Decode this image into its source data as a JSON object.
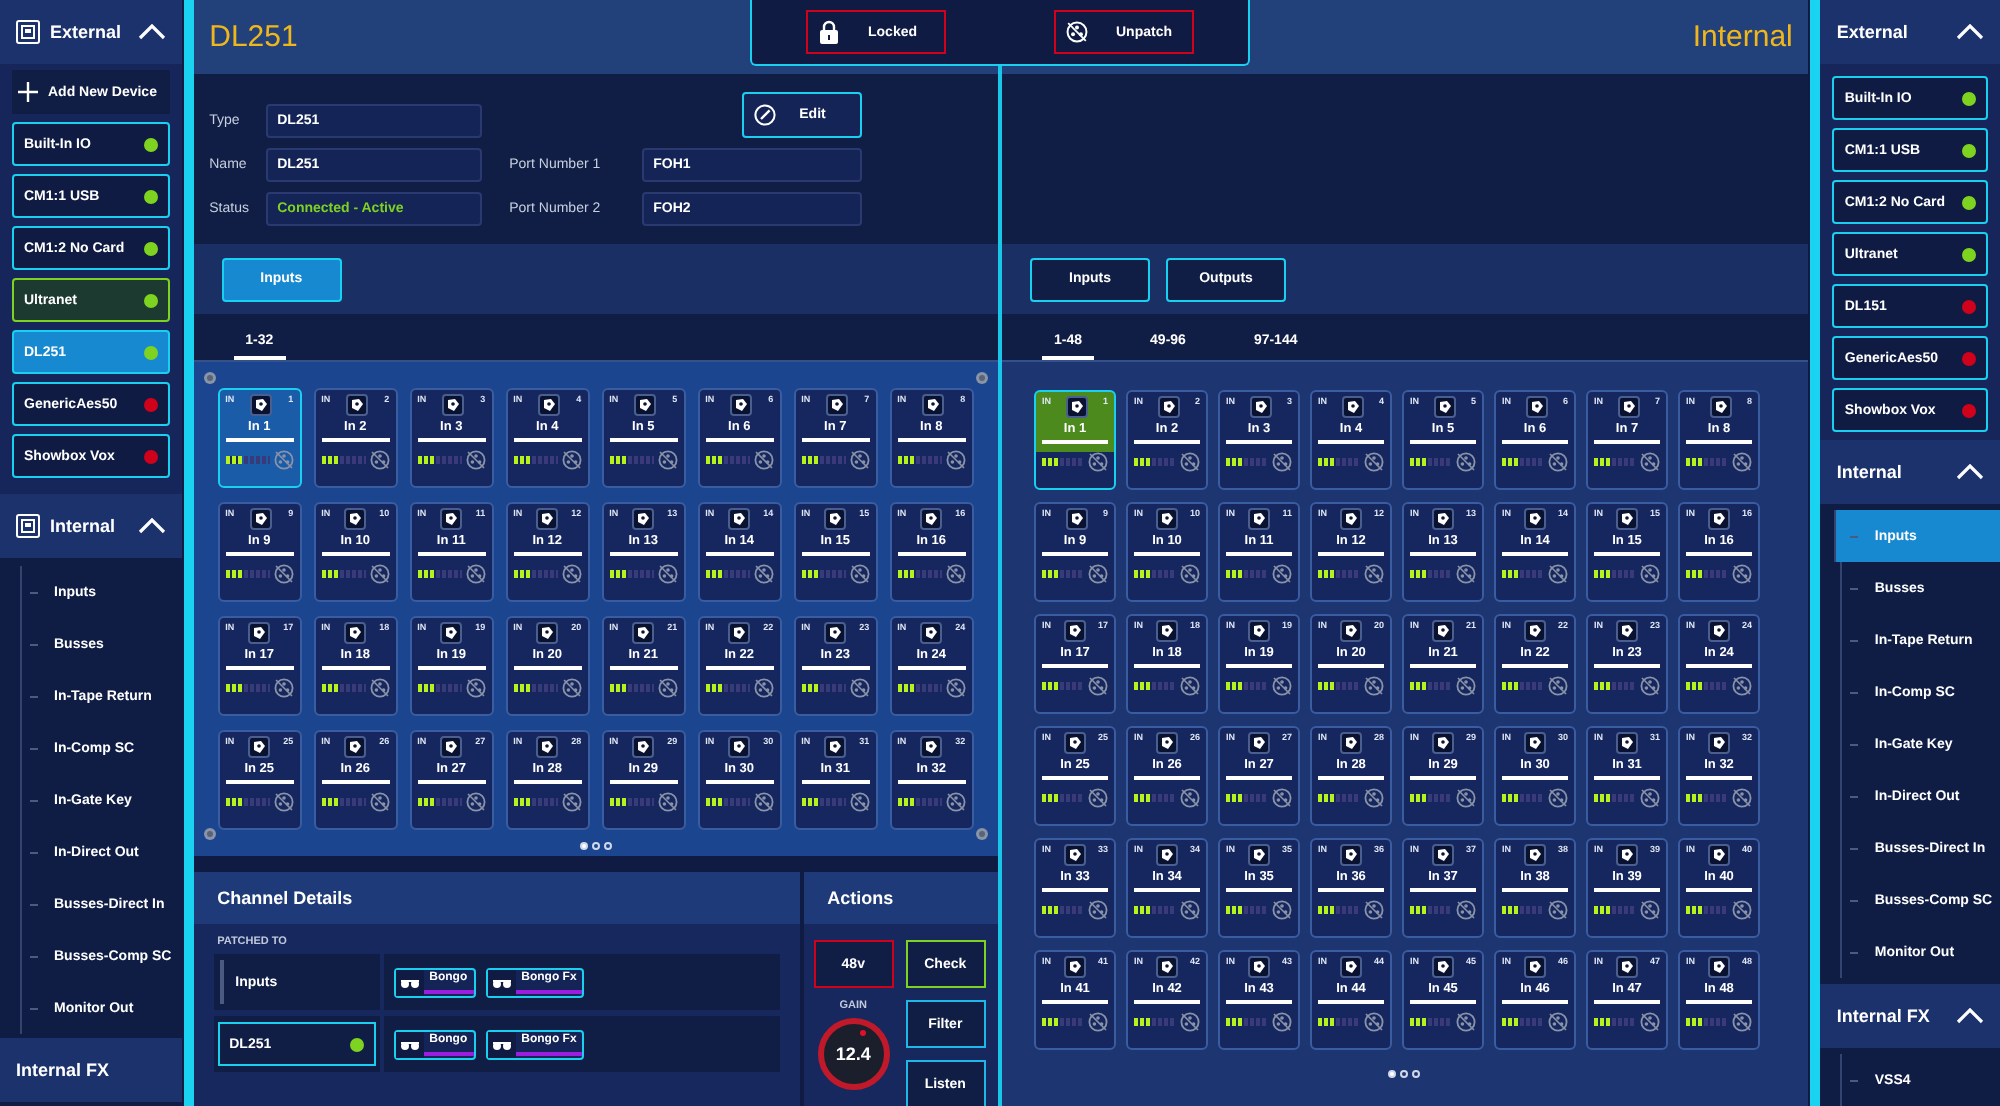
{
  "left_sidebar": {
    "external": {
      "title": "External",
      "expanded": true,
      "add_button": "Add New Device",
      "devices": [
        {
          "name": "Built-In IO",
          "color": "#7ed321",
          "selected": false,
          "linked": false
        },
        {
          "name": "CM1:1 USB",
          "color": "#7ed321",
          "selected": false,
          "linked": false
        },
        {
          "name": "CM1:2 No Card",
          "color": "#7ed321",
          "selected": false,
          "linked": false
        },
        {
          "name": "Ultranet",
          "color": "#7ed321",
          "selected": false,
          "linked": true
        },
        {
          "name": "DL251",
          "color": "#7ed321",
          "selected": true,
          "linked": false
        },
        {
          "name": "GenericAes50",
          "color": "#d0021b",
          "selected": false,
          "linked": false
        },
        {
          "name": "Showbox Vox",
          "color": "#d0021b",
          "selected": false,
          "linked": false
        }
      ]
    },
    "internal": {
      "title": "Internal",
      "expanded": true,
      "items": [
        {
          "label": "Inputs",
          "selected": false
        },
        {
          "label": "Busses",
          "selected": false
        },
        {
          "label": "In-Tape Return",
          "selected": false
        },
        {
          "label": "In-Comp SC",
          "selected": false
        },
        {
          "label": "In-Gate Key",
          "selected": false
        },
        {
          "label": "In-Direct Out",
          "selected": false
        },
        {
          "label": "Busses-Direct In",
          "selected": false
        },
        {
          "label": "Busses-Comp SC",
          "selected": false
        },
        {
          "label": "Monitor Out",
          "selected": false
        }
      ]
    },
    "internal_fx": {
      "title": "Internal FX",
      "expanded": false
    }
  },
  "toolbar": {
    "buttons": [
      {
        "label": "Locked",
        "kind": "lock"
      },
      {
        "label": "Unpatch",
        "kind": "unpatch"
      }
    ]
  },
  "device_panel": {
    "title": "DL251",
    "edit_button": "Edit",
    "fields": [
      {
        "label": "Type",
        "value": "DL251",
        "kind": "plain"
      },
      {
        "label": "Name",
        "value": "DL251",
        "kind": "plain"
      },
      {
        "label": "Status",
        "value": "Connected - Active",
        "kind": "status"
      }
    ],
    "port_fields": [
      {
        "label": "Port Number 1",
        "value": "FOH1"
      },
      {
        "label": "Port Number 2",
        "value": "FOH2"
      }
    ],
    "tabs": [
      {
        "label": "Inputs",
        "selected": true
      }
    ],
    "ranges": [
      {
        "label": "1-32",
        "selected": true
      }
    ],
    "channels": [
      {
        "tag": "IN",
        "number": "1",
        "name": "In 1",
        "selected": true,
        "level": 0.375
      },
      {
        "tag": "IN",
        "number": "2",
        "name": "In 2",
        "selected": false,
        "level": 0.375
      },
      {
        "tag": "IN",
        "number": "3",
        "name": "In 3",
        "selected": false,
        "level": 0.375
      },
      {
        "tag": "IN",
        "number": "4",
        "name": "In 4",
        "selected": false,
        "level": 0.375
      },
      {
        "tag": "IN",
        "number": "5",
        "name": "In 5",
        "selected": false,
        "level": 0.375
      },
      {
        "tag": "IN",
        "number": "6",
        "name": "In 6",
        "selected": false,
        "level": 0.375
      },
      {
        "tag": "IN",
        "number": "7",
        "name": "In 7",
        "selected": false,
        "level": 0.375
      },
      {
        "tag": "IN",
        "number": "8",
        "name": "In 8",
        "selected": false,
        "level": 0.375
      },
      {
        "tag": "IN",
        "number": "9",
        "name": "In 9",
        "selected": false,
        "level": 0.375
      },
      {
        "tag": "IN",
        "number": "10",
        "name": "In 10",
        "selected": false,
        "level": 0.375
      },
      {
        "tag": "IN",
        "number": "11",
        "name": "In 11",
        "selected": false,
        "level": 0.375
      },
      {
        "tag": "IN",
        "number": "12",
        "name": "In 12",
        "selected": false,
        "level": 0.375
      },
      {
        "tag": "IN",
        "number": "13",
        "name": "In 13",
        "selected": false,
        "level": 0.375
      },
      {
        "tag": "IN",
        "number": "14",
        "name": "In 14",
        "selected": false,
        "level": 0.375
      },
      {
        "tag": "IN",
        "number": "15",
        "name": "In 15",
        "selected": false,
        "level": 0.375
      },
      {
        "tag": "IN",
        "number": "16",
        "name": "In 16",
        "selected": false,
        "level": 0.375
      },
      {
        "tag": "IN",
        "number": "17",
        "name": "In 17",
        "selected": false,
        "level": 0.375
      },
      {
        "tag": "IN",
        "number": "18",
        "name": "In 18",
        "selected": false,
        "level": 0.375
      },
      {
        "tag": "IN",
        "number": "19",
        "name": "In 19",
        "selected": false,
        "level": 0.375
      },
      {
        "tag": "IN",
        "number": "20",
        "name": "In 20",
        "selected": false,
        "level": 0.375
      },
      {
        "tag": "IN",
        "number": "21",
        "name": "In 21",
        "selected": false,
        "level": 0.375
      },
      {
        "tag": "IN",
        "number": "22",
        "name": "In 22",
        "selected": false,
        "level": 0.375
      },
      {
        "tag": "IN",
        "number": "23",
        "name": "In 23",
        "selected": false,
        "level": 0.375
      },
      {
        "tag": "IN",
        "number": "24",
        "name": "In 24",
        "selected": false,
        "level": 0.375
      },
      {
        "tag": "IN",
        "number": "25",
        "name": "In 25",
        "selected": false,
        "level": 0.375
      },
      {
        "tag": "IN",
        "number": "26",
        "name": "In 26",
        "selected": false,
        "level": 0.375
      },
      {
        "tag": "IN",
        "number": "27",
        "name": "In 27",
        "selected": false,
        "level": 0.375
      },
      {
        "tag": "IN",
        "number": "28",
        "name": "In 28",
        "selected": false,
        "level": 0.375
      },
      {
        "tag": "IN",
        "number": "29",
        "name": "In 29",
        "selected": false,
        "level": 0.375
      },
      {
        "tag": "IN",
        "number": "30",
        "name": "In 30",
        "selected": false,
        "level": 0.375
      },
      {
        "tag": "IN",
        "number": "31",
        "name": "In 31",
        "selected": false,
        "level": 0.375
      },
      {
        "tag": "IN",
        "number": "32",
        "name": "In 32",
        "selected": false,
        "level": 0.375
      }
    ],
    "pages": [
      {
        "selected": true
      },
      {
        "selected": false
      },
      {
        "selected": false
      }
    ]
  },
  "internal_panel": {
    "title": "Internal",
    "tabs": [
      {
        "label": "Inputs",
        "selected": false
      },
      {
        "label": "Outputs",
        "selected": false
      }
    ],
    "ranges": [
      {
        "label": "1-48",
        "selected": true
      },
      {
        "label": "49-96",
        "selected": false
      },
      {
        "label": "97-144",
        "selected": false
      }
    ],
    "channels": [
      {
        "tag": "IN",
        "number": "1",
        "name": "In 1",
        "selected": true,
        "level": 0.375
      },
      {
        "tag": "IN",
        "number": "2",
        "name": "In 2",
        "selected": false,
        "level": 0.375
      },
      {
        "tag": "IN",
        "number": "3",
        "name": "In 3",
        "selected": false,
        "level": 0.375
      },
      {
        "tag": "IN",
        "number": "4",
        "name": "In 4",
        "selected": false,
        "level": 0.375
      },
      {
        "tag": "IN",
        "number": "5",
        "name": "In 5",
        "selected": false,
        "level": 0.375
      },
      {
        "tag": "IN",
        "number": "6",
        "name": "In 6",
        "selected": false,
        "level": 0.375
      },
      {
        "tag": "IN",
        "number": "7",
        "name": "In 7",
        "selected": false,
        "level": 0.375
      },
      {
        "tag": "IN",
        "number": "8",
        "name": "In 8",
        "selected": false,
        "level": 0.375
      },
      {
        "tag": "IN",
        "number": "9",
        "name": "In 9",
        "selected": false,
        "level": 0.375
      },
      {
        "tag": "IN",
        "number": "10",
        "name": "In 10",
        "selected": false,
        "level": 0.375
      },
      {
        "tag": "IN",
        "number": "11",
        "name": "In 11",
        "selected": false,
        "level": 0.375
      },
      {
        "tag": "IN",
        "number": "12",
        "name": "In 12",
        "selected": false,
        "level": 0.375
      },
      {
        "tag": "IN",
        "number": "13",
        "name": "In 13",
        "selected": false,
        "level": 0.375
      },
      {
        "tag": "IN",
        "number": "14",
        "name": "In 14",
        "selected": false,
        "level": 0.375
      },
      {
        "tag": "IN",
        "number": "15",
        "name": "In 15",
        "selected": false,
        "level": 0.375
      },
      {
        "tag": "IN",
        "number": "16",
        "name": "In 16",
        "selected": false,
        "level": 0.375
      },
      {
        "tag": "IN",
        "number": "17",
        "name": "In 17",
        "selected": false,
        "level": 0.375
      },
      {
        "tag": "IN",
        "number": "18",
        "name": "In 18",
        "selected": false,
        "level": 0.375
      },
      {
        "tag": "IN",
        "number": "19",
        "name": "In 19",
        "selected": false,
        "level": 0.375
      },
      {
        "tag": "IN",
        "number": "20",
        "name": "In 20",
        "selected": false,
        "level": 0.375
      },
      {
        "tag": "IN",
        "number": "21",
        "name": "In 21",
        "selected": false,
        "level": 0.375
      },
      {
        "tag": "IN",
        "number": "22",
        "name": "In 22",
        "selected": false,
        "level": 0.375
      },
      {
        "tag": "IN",
        "number": "23",
        "name": "In 23",
        "selected": false,
        "level": 0.375
      },
      {
        "tag": "IN",
        "number": "24",
        "name": "In 24",
        "selected": false,
        "level": 0.375
      },
      {
        "tag": "IN",
        "number": "25",
        "name": "In 25",
        "selected": false,
        "level": 0.375
      },
      {
        "tag": "IN",
        "number": "26",
        "name": "In 26",
        "selected": false,
        "level": 0.375
      },
      {
        "tag": "IN",
        "number": "27",
        "name": "In 27",
        "selected": false,
        "level": 0.375
      },
      {
        "tag": "IN",
        "number": "28",
        "name": "In 28",
        "selected": false,
        "level": 0.375
      },
      {
        "tag": "IN",
        "number": "29",
        "name": "In 29",
        "selected": false,
        "level": 0.375
      },
      {
        "tag": "IN",
        "number": "30",
        "name": "In 30",
        "selected": false,
        "level": 0.375
      },
      {
        "tag": "IN",
        "number": "31",
        "name": "In 31",
        "selected": false,
        "level": 0.375
      },
      {
        "tag": "IN",
        "number": "32",
        "name": "In 32",
        "selected": false,
        "level": 0.375
      },
      {
        "tag": "IN",
        "number": "33",
        "name": "In 33",
        "selected": false,
        "level": 0.375
      },
      {
        "tag": "IN",
        "number": "34",
        "name": "In 34",
        "selected": false,
        "level": 0.375
      },
      {
        "tag": "IN",
        "number": "35",
        "name": "In 35",
        "selected": false,
        "level": 0.375
      },
      {
        "tag": "IN",
        "number": "36",
        "name": "In 36",
        "selected": false,
        "level": 0.375
      },
      {
        "tag": "IN",
        "number": "37",
        "name": "In 37",
        "selected": false,
        "level": 0.375
      },
      {
        "tag": "IN",
        "number": "38",
        "name": "In 38",
        "selected": false,
        "level": 0.375
      },
      {
        "tag": "IN",
        "number": "39",
        "name": "In 39",
        "selected": false,
        "level": 0.375
      },
      {
        "tag": "IN",
        "number": "40",
        "name": "In 40",
        "selected": false,
        "level": 0.375
      },
      {
        "tag": "IN",
        "number": "41",
        "name": "In 41",
        "selected": false,
        "level": 0.375
      },
      {
        "tag": "IN",
        "number": "42",
        "name": "In 42",
        "selected": false,
        "level": 0.375
      },
      {
        "tag": "IN",
        "number": "43",
        "name": "In 43",
        "selected": false,
        "level": 0.375
      },
      {
        "tag": "IN",
        "number": "44",
        "name": "In 44",
        "selected": false,
        "level": 0.375
      },
      {
        "tag": "IN",
        "number": "45",
        "name": "In 45",
        "selected": false,
        "level": 0.375
      },
      {
        "tag": "IN",
        "number": "46",
        "name": "In 46",
        "selected": false,
        "level": 0.375
      },
      {
        "tag": "IN",
        "number": "47",
        "name": "In 47",
        "selected": false,
        "level": 0.375
      },
      {
        "tag": "IN",
        "number": "48",
        "name": "In 48",
        "selected": false,
        "level": 0.375
      }
    ],
    "pages": [
      {
        "selected": true
      },
      {
        "selected": false
      },
      {
        "selected": false
      }
    ]
  },
  "channel_details": {
    "title": "Channel Details",
    "patched_to_label": "PATCHED TO",
    "rows": [
      {
        "source": "Inputs",
        "kind": "group",
        "targets": [
          "Bongo",
          "Bongo Fx"
        ]
      },
      {
        "source": "DL251",
        "kind": "device",
        "color": "#7ed321",
        "targets": [
          "Bongo",
          "Bongo Fx"
        ]
      }
    ]
  },
  "actions": {
    "title": "Actions",
    "buttons": [
      {
        "label": "48v",
        "color": "#d0021b"
      },
      {
        "label": "Check",
        "color": "#7ed321"
      },
      {
        "label": "Filter",
        "color": "#1fb6e8"
      },
      {
        "label": "Listen",
        "color": "#1fb6e8"
      }
    ],
    "gain": {
      "label": "GAIN",
      "value": "12.4"
    }
  },
  "right_sidebar": {
    "external": {
      "title": "External",
      "expanded": true,
      "devices": [
        {
          "name": "Built-In IO",
          "color": "#7ed321",
          "selected": false,
          "linked": false
        },
        {
          "name": "CM1:1 USB",
          "color": "#7ed321",
          "selected": false,
          "linked": false
        },
        {
          "name": "CM1:2 No Card",
          "color": "#7ed321",
          "selected": false,
          "linked": false
        },
        {
          "name": "Ultranet",
          "color": "#7ed321",
          "selected": false,
          "linked": false
        },
        {
          "name": "DL151",
          "color": "#d0021b",
          "selected": false,
          "linked": false
        },
        {
          "name": "GenericAes50",
          "color": "#d0021b",
          "selected": false,
          "linked": false
        },
        {
          "name": "Showbox Vox",
          "color": "#d0021b",
          "selected": false,
          "linked": false
        }
      ]
    },
    "internal": {
      "title": "Internal",
      "expanded": true,
      "items": [
        {
          "label": "Inputs",
          "selected": true
        },
        {
          "label": "Busses",
          "selected": false
        },
        {
          "label": "In-Tape Return",
          "selected": false
        },
        {
          "label": "In-Comp SC",
          "selected": false
        },
        {
          "label": "In-Gate Key",
          "selected": false
        },
        {
          "label": "In-Direct Out",
          "selected": false
        },
        {
          "label": "Busses-Direct In",
          "selected": false
        },
        {
          "label": "Busses-Comp SC",
          "selected": false
        },
        {
          "label": "Monitor Out",
          "selected": false
        }
      ]
    },
    "internal_fx": {
      "title": "Internal FX",
      "expanded": true,
      "items": [
        {
          "label": "VSS4",
          "selected": false
        }
      ]
    }
  }
}
